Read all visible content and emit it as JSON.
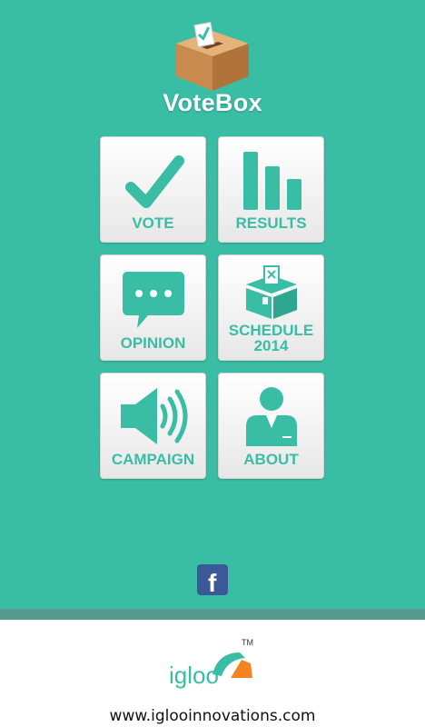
{
  "app": {
    "title": "VoteBox",
    "accent_color": "#39BEA5"
  },
  "menu": [
    {
      "id": "vote",
      "label": "VOTE",
      "icon": "checkmark-icon"
    },
    {
      "id": "results",
      "label": "RESULTS",
      "icon": "bar-chart-icon"
    },
    {
      "id": "opinion",
      "label": "OPINION",
      "icon": "speech-bubble-icon"
    },
    {
      "id": "schedule",
      "label_line1": "SCHEDULE",
      "label_line2": "2014",
      "icon": "ballot-box-icon"
    },
    {
      "id": "campaign",
      "label": "CAMPAIGN",
      "icon": "speaker-icon"
    },
    {
      "id": "about",
      "label": "ABOUT",
      "icon": "person-icon"
    }
  ],
  "social": {
    "icon": "facebook-icon",
    "text": "f"
  },
  "footer": {
    "brand": "igloo",
    "tm": "TM",
    "url": "www.iglooinnovations.com"
  }
}
